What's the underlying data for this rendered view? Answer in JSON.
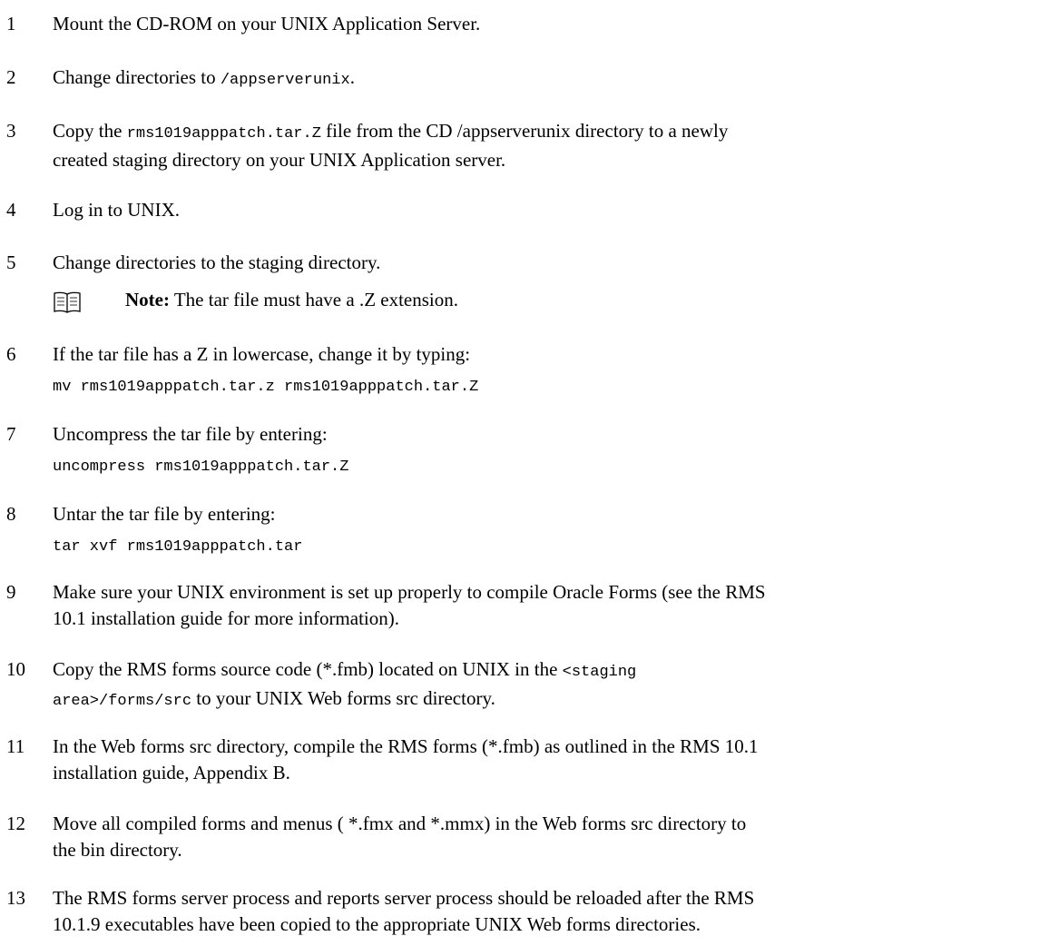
{
  "steps": [
    {
      "num": "1",
      "lines": [
        [
          "Mount the CD-ROM on your UNIX Application Server."
        ]
      ]
    },
    {
      "num": "2",
      "lines": [
        [
          "Change directories to ",
          {
            "code": "/appserverunix"
          },
          "."
        ]
      ]
    },
    {
      "num": "3",
      "lines": [
        [
          "Copy the ",
          {
            "code": "rms1019apppatch.tar.Z"
          },
          " file from the CD /appserverunix directory to a newly"
        ],
        [
          "created staging directory on your UNIX Application server."
        ]
      ]
    },
    {
      "num": "4",
      "lines": [
        [
          "Log in to UNIX."
        ]
      ]
    },
    {
      "num": "5",
      "lines": [
        [
          "Change directories to the staging directory."
        ]
      ]
    },
    {
      "num": "6",
      "lines": [
        [
          "If the tar file has a Z in lowercase, change it by typing:"
        ]
      ]
    },
    {
      "num": "7",
      "lines": [
        [
          "Uncompress the tar file by entering:"
        ]
      ]
    },
    {
      "num": "8",
      "lines": [
        [
          "Untar the tar file by entering:"
        ]
      ]
    },
    {
      "num": "9",
      "lines": [
        [
          "Make sure your UNIX environment is set up properly to compile Oracle Forms (see the RMS"
        ],
        [
          "10.1 installation guide for more information)."
        ]
      ]
    },
    {
      "num": "10",
      "lines": [
        [
          "Copy the RMS forms source code (*.fmb) located on UNIX in the ",
          {
            "code": "<staging"
          }
        ],
        [
          {
            "code": "area>/forms/src"
          },
          " to your UNIX Web forms src directory."
        ]
      ]
    },
    {
      "num": "11",
      "lines": [
        [
          "In the Web forms src directory, compile the RMS forms (*.fmb) as outlined in the RMS 10.1"
        ],
        [
          "installation guide, Appendix B."
        ]
      ]
    },
    {
      "num": "12",
      "lines": [
        [
          "Move all compiled forms and menus ( *.fmx and *.mmx) in the Web forms src directory to"
        ],
        [
          "the bin directory."
        ]
      ]
    },
    {
      "num": "13",
      "lines": [
        [
          "The RMS forms server process and reports server process should be reloaded after the RMS"
        ],
        [
          "10.1.9 executables have been copied to the appropriate UNIX Web forms directories."
        ]
      ]
    }
  ],
  "commands": {
    "step6": "mv rms1019apppatch.tar.z rms1019apppatch.tar.Z",
    "step7": "uncompress rms1019apppatch.tar.Z",
    "step8": "tar xvf rms1019apppatch.tar"
  },
  "note": {
    "icon": "book-icon",
    "label": "Note:",
    "text": " The tar file must have a .Z extension."
  }
}
